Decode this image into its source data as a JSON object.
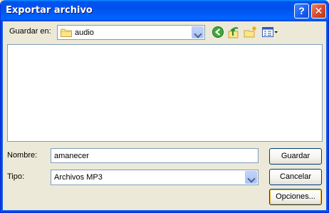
{
  "window": {
    "title": "Exportar archivo",
    "help_glyph": "?",
    "close_glyph": "✕"
  },
  "toolbar": {
    "look_in_label": "Guardar en:",
    "look_in_value": "audio",
    "icons": [
      "folder-icon",
      "back-icon",
      "up-folder-icon",
      "new-folder-icon",
      "view-menu-icon"
    ]
  },
  "file_list": {
    "items": []
  },
  "form": {
    "name_label": "Nombre:",
    "name_value": "amanecer",
    "type_label": "Tipo:",
    "type_value": "Archivos MP3"
  },
  "buttons": {
    "save": "Guardar",
    "cancel": "Cancelar",
    "options": "Opciones..."
  },
  "colors": {
    "titlebar": "#0053ee",
    "dialog_bg": "#ece9d8",
    "field_border": "#7f9db9"
  }
}
